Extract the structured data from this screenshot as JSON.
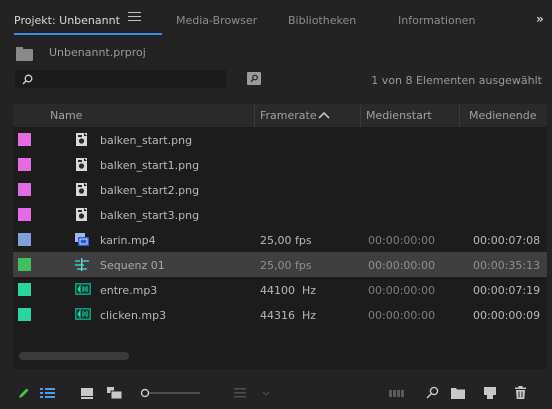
{
  "tabs": [
    {
      "label": "Projekt: Unbenannt",
      "active": true
    },
    {
      "label": "Media-Browser",
      "active": false
    },
    {
      "label": "Bibliotheken",
      "active": false
    },
    {
      "label": "Informationen",
      "active": false
    }
  ],
  "tab_overflow_label": "»",
  "project": {
    "file_name": "Unbenannt.prproj"
  },
  "search": {
    "placeholder": "",
    "value": ""
  },
  "selection_status": "1 von 8 Elementen ausgewählt",
  "columns": {
    "name": "Name",
    "framerate": "Framerate",
    "media_start": "Medienstart",
    "media_end": "Medienende"
  },
  "sort": {
    "column": "Framerate",
    "direction": "ascending"
  },
  "items": [
    {
      "name": "balken_start.png",
      "label_color": "#e36be6",
      "icon": "image-file-icon",
      "framerate": "",
      "media_start": "",
      "media_end": "",
      "selected": false
    },
    {
      "name": "balken_start1.png",
      "label_color": "#e36be6",
      "icon": "image-file-icon",
      "framerate": "",
      "media_start": "",
      "media_end": "",
      "selected": false
    },
    {
      "name": "balken_start2.png",
      "label_color": "#e36be6",
      "icon": "image-file-icon",
      "framerate": "",
      "media_start": "",
      "media_end": "",
      "selected": false
    },
    {
      "name": "balken_start3.png",
      "label_color": "#e36be6",
      "icon": "image-file-icon",
      "framerate": "",
      "media_start": "",
      "media_end": "",
      "selected": false
    },
    {
      "name": "karin.mp4",
      "label_color": "#7f9fdd",
      "icon": "video-file-icon",
      "framerate": "25,00 fps",
      "media_start": "00:00:00:00",
      "media_end": "00:00:07:08",
      "selected": false
    },
    {
      "name": "Sequenz 01",
      "label_color": "#3fbf5f",
      "icon": "sequence-icon",
      "framerate": "25,00 fps",
      "media_start": "00:00:00:00",
      "media_end": "00:00:35:13",
      "selected": true
    },
    {
      "name": "entre.mp3",
      "label_color": "#2ad6a0",
      "icon": "audio-file-icon",
      "framerate": "44100  Hz",
      "media_start": "00:00:00:00",
      "media_end": "00:00:07:19",
      "selected": false
    },
    {
      "name": "clicken.mp3",
      "label_color": "#2ad6a0",
      "icon": "audio-file-icon",
      "framerate": "44316  Hz",
      "media_start": "00:00:00:00",
      "media_end": "00:00:00:09",
      "selected": false
    }
  ],
  "toolbar": {
    "icons": [
      "pencil-icon",
      "list-view-icon",
      "icon-view-icon",
      "freeform-view-icon",
      "zoom-slider",
      "sort-icons-icon",
      "automate-to-sequence-icon",
      "find-icon",
      "new-bin-icon",
      "new-item-icon",
      "delete-icon"
    ]
  },
  "colors": {
    "accent": "#3b8ae6",
    "pencil": "#4ac24a",
    "list_view": "#4a9bf2"
  }
}
